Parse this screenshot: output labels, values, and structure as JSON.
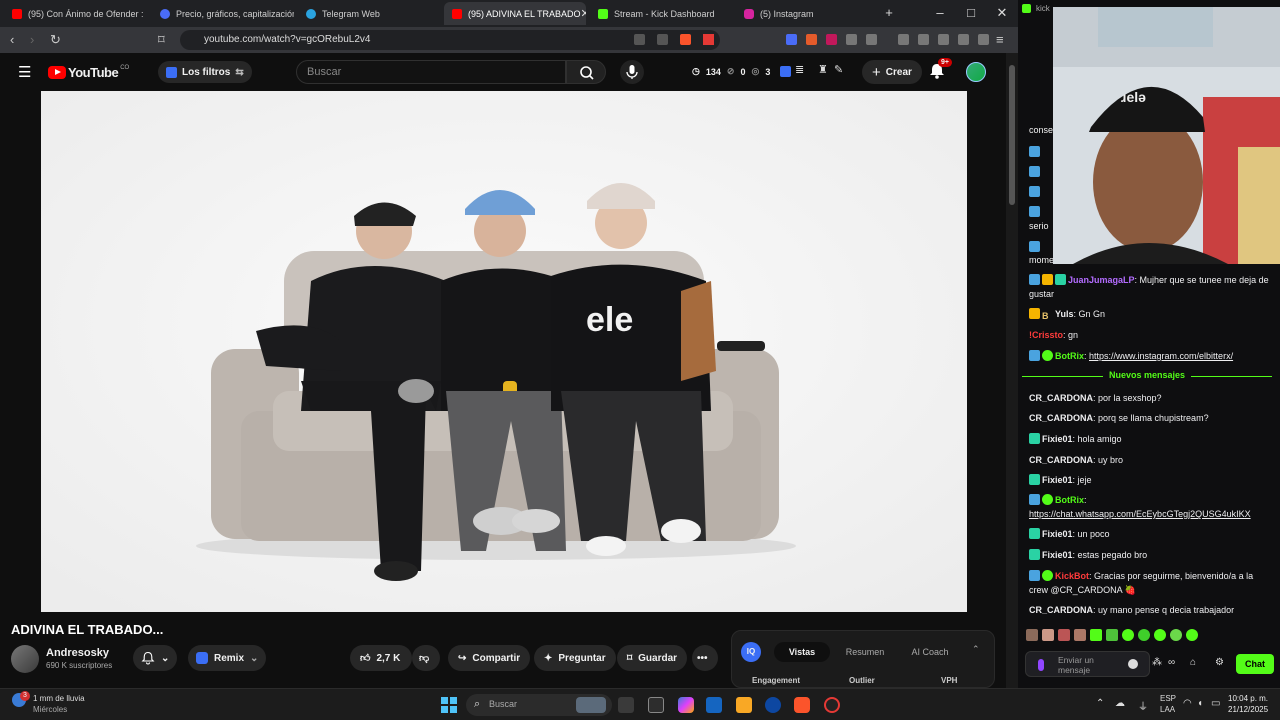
{
  "browser": {
    "tabs": [
      {
        "label": "(95) Con Ánimo de Ofender : Ca",
        "color": "#ff0000",
        "active": false
      },
      {
        "label": "Precio, gráficos, capitalización d",
        "color": "#4a6cf7",
        "active": false
      },
      {
        "label": "Telegram Web",
        "color": "#2aa3e0",
        "active": false
      },
      {
        "label": "(95) ADIVINA EL TRABADO",
        "color": "#ff0000",
        "active": true
      },
      {
        "label": "Stream - Kick Dashboard",
        "color": "#53fc18",
        "active": false
      },
      {
        "label": "(5) Instagram",
        "color": "#d6249f",
        "active": false
      }
    ],
    "new_tab": "+",
    "url": "youtube.com/watch?v=gcORebuL2v4"
  },
  "youtube": {
    "logo_text": "YouTube",
    "country": "CO",
    "filters_label": "Los filtros",
    "search_placeholder": "Buscar",
    "stats": {
      "views": "134",
      "a": "0",
      "b": "3"
    },
    "create_label": "Crear",
    "notif_count": "9+"
  },
  "video": {
    "title": "ADIVINA EL TRABADO...",
    "channel": "Andresosky",
    "subscribers": "690 K suscriptores",
    "remix_label": "Remix",
    "likes": "2,7 K",
    "share_label": "Compartir",
    "ask_label": "Preguntar",
    "save_label": "Guardar",
    "more": "•••"
  },
  "iq_panel": {
    "badge": "IQ",
    "tabs": [
      "Vistas",
      "Resumen",
      "AI Coach"
    ],
    "columns": [
      "Engagement",
      "Outlier",
      "VPH"
    ]
  },
  "chat": {
    "top_partial": "kick",
    "partial_words": [
      "conse",
      "serio",
      "mome"
    ],
    "messages": [
      {
        "user": "JuanJumagaLP",
        "color": "#b36cff",
        "text": ": Mujher que se tunee me deja de gustar"
      },
      {
        "user": "Yuls",
        "color": "#efeff1",
        "text": ": Gn Gn"
      },
      {
        "user": "!Crissto",
        "color": "#ff3b3b",
        "text": ": gn"
      },
      {
        "user": "BotRix",
        "color": "#53fc18",
        "text": ": ",
        "link": "https://www.instagram.com/elbitterx/"
      },
      {
        "user": "CR_CARDONA",
        "color": "#efeff1",
        "text": ": por la sexshop?"
      },
      {
        "user": "CR_CARDONA",
        "color": "#efeff1",
        "text": ": porq se llama chupistream?"
      },
      {
        "user": "Fixie01",
        "color": "#efeff1",
        "text": ": hola amigo"
      },
      {
        "user": "CR_CARDONA",
        "color": "#efeff1",
        "text": ": uy bro"
      },
      {
        "user": "Fixie01",
        "color": "#efeff1",
        "text": ": jeje"
      },
      {
        "user": "BotRix",
        "color": "#53fc18",
        "text": ":",
        "link": "https://chat.whatsapp.com/EcEybcGTegj2QUSG4ukIKX"
      },
      {
        "user": "Fixie01",
        "color": "#efeff1",
        "text": ": un poco"
      },
      {
        "user": "Fixie01",
        "color": "#efeff1",
        "text": ": estas pegado bro"
      },
      {
        "user": "KickBot",
        "color": "#ff3b3b",
        "text": ": Gracias por seguirme, bienvenido/a a la crew @CR_CARDONA 🍓"
      },
      {
        "user": "CR_CARDONA",
        "color": "#efeff1",
        "text": ": uy mano pense q decia trabajador"
      }
    ],
    "new_messages_label": "Nuevos mensajes",
    "input_placeholder": "Enviar un mensaje",
    "send_label": "Chat"
  },
  "taskbar": {
    "weather_count": "3",
    "weather": "1 mm de lluvia",
    "weather_day": "Miércoles",
    "search_placeholder": "Buscar",
    "lang": "ESP",
    "lang2": "LAA",
    "time": "10:04 p. m.",
    "date": "21/12/2025"
  }
}
